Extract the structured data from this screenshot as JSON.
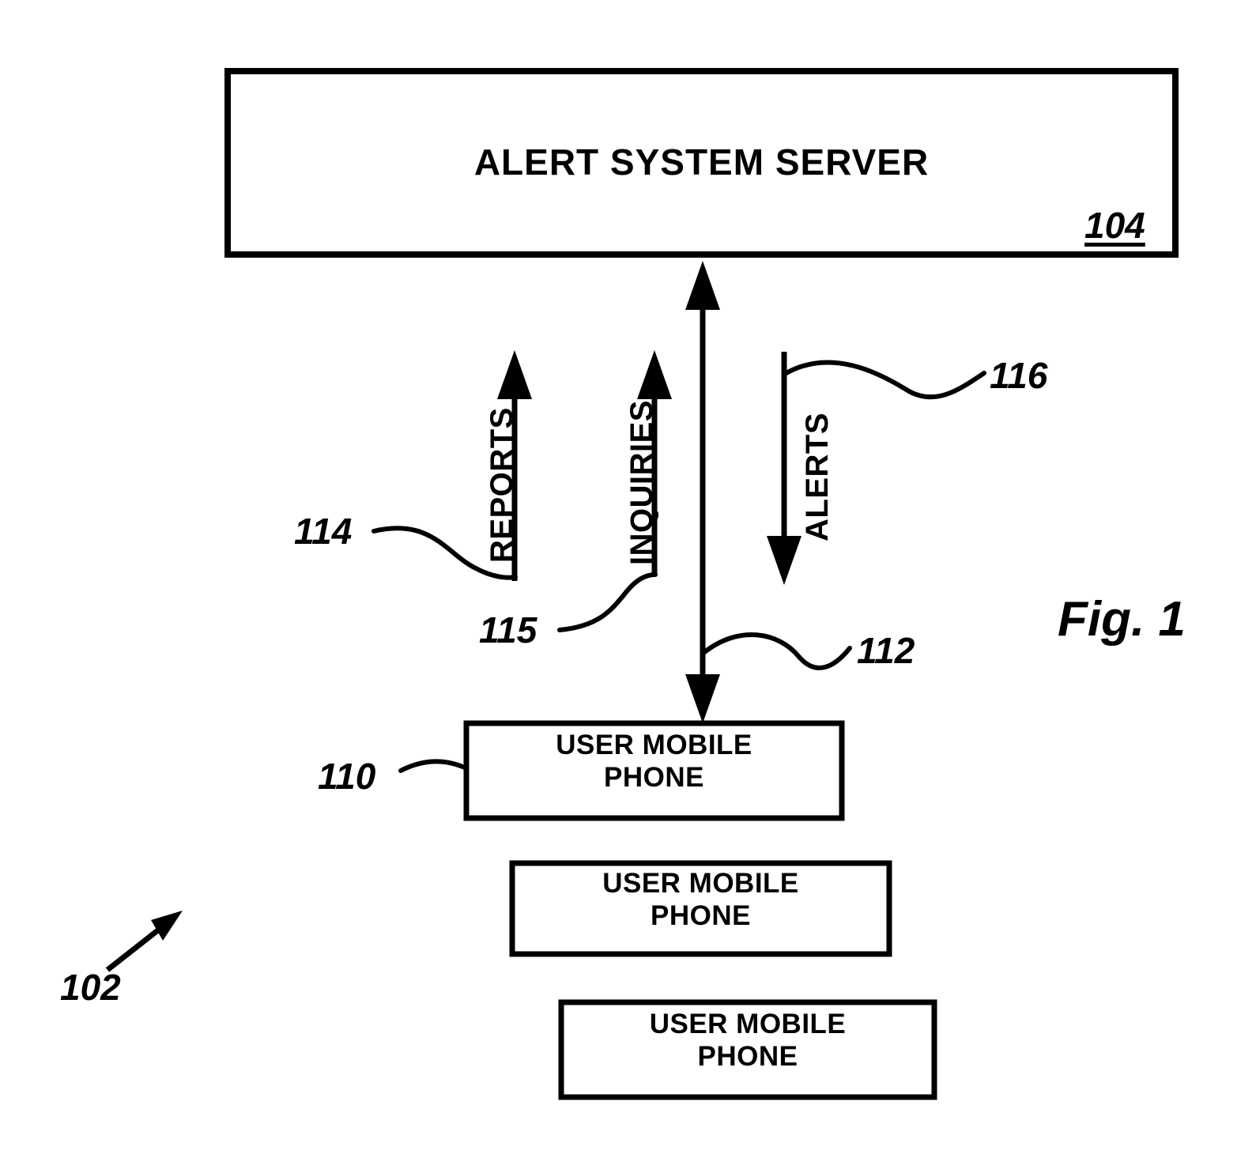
{
  "figure": {
    "caption": "Fig. 1",
    "system_ref": "102"
  },
  "nodes": {
    "server": {
      "label": "ALERT SYSTEM SERVER",
      "ref": "104"
    },
    "phones": [
      {
        "label": "USER MOBILE\nPHONE",
        "ref": "110"
      },
      {
        "label": "USER MOBILE\nPHONE",
        "ref": ""
      },
      {
        "label": "USER MOBILE\nPHONE",
        "ref": ""
      }
    ]
  },
  "flows": [
    {
      "name": "reports",
      "label": "REPORTS",
      "ref": "114",
      "direction": "up"
    },
    {
      "name": "inquiries",
      "label": "INQUIRIES",
      "ref": "115",
      "direction": "up"
    },
    {
      "name": "alerts",
      "label": "ALERTS",
      "ref": "116",
      "direction": "down"
    },
    {
      "name": "link",
      "label": "",
      "ref": "112",
      "direction": "bidirectional"
    }
  ],
  "colors": {
    "stroke": "#000000",
    "background": "#ffffff"
  }
}
